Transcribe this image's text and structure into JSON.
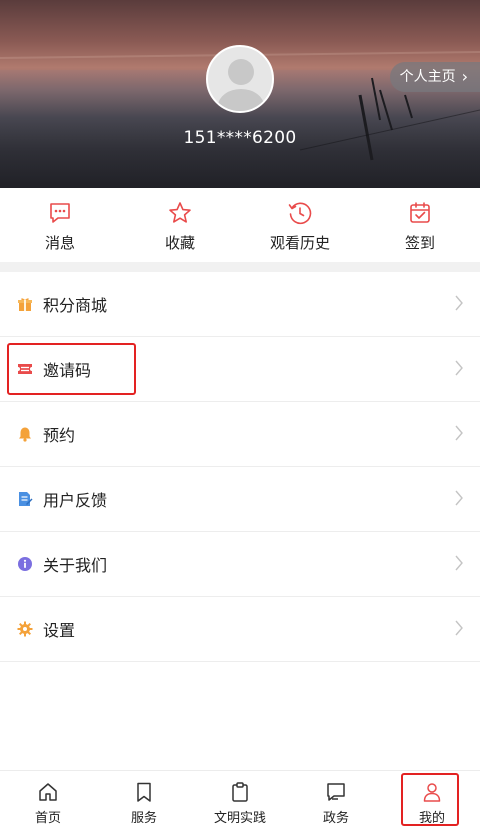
{
  "profile": {
    "phone": "151****6200",
    "homepage_label": "个人主页",
    "homepage_chevron": "›"
  },
  "quick_actions": [
    {
      "label": "消息",
      "icon": "message-icon"
    },
    {
      "label": "收藏",
      "icon": "star-icon"
    },
    {
      "label": "观看历史",
      "icon": "history-icon"
    },
    {
      "label": "签到",
      "icon": "calendar-check-icon"
    }
  ],
  "menu": [
    {
      "label": "积分商城",
      "icon": "gift-icon",
      "icon_color": "#f4a23a"
    },
    {
      "label": "邀请码",
      "icon": "ticket-icon",
      "icon_color": "#e94b4b"
    },
    {
      "label": "预约",
      "icon": "bell-icon",
      "icon_color": "#f4a23a"
    },
    {
      "label": "用户反馈",
      "icon": "feedback-doc-icon",
      "icon_color": "#4a90e2"
    },
    {
      "label": "关于我们",
      "icon": "info-icon",
      "icon_color": "#7b6fe0"
    },
    {
      "label": "设置",
      "icon": "gear-icon",
      "icon_color": "#f4a23a"
    }
  ],
  "tabs": [
    {
      "label": "首页",
      "icon": "home-icon"
    },
    {
      "label": "服务",
      "icon": "bookmark-icon"
    },
    {
      "label": "文明实践",
      "icon": "clipboard-icon"
    },
    {
      "label": "政务",
      "icon": "chat-icon"
    },
    {
      "label": "我的",
      "icon": "user-icon"
    }
  ],
  "colors": {
    "accent": "#e94b4b",
    "highlight_border": "#e32222"
  }
}
